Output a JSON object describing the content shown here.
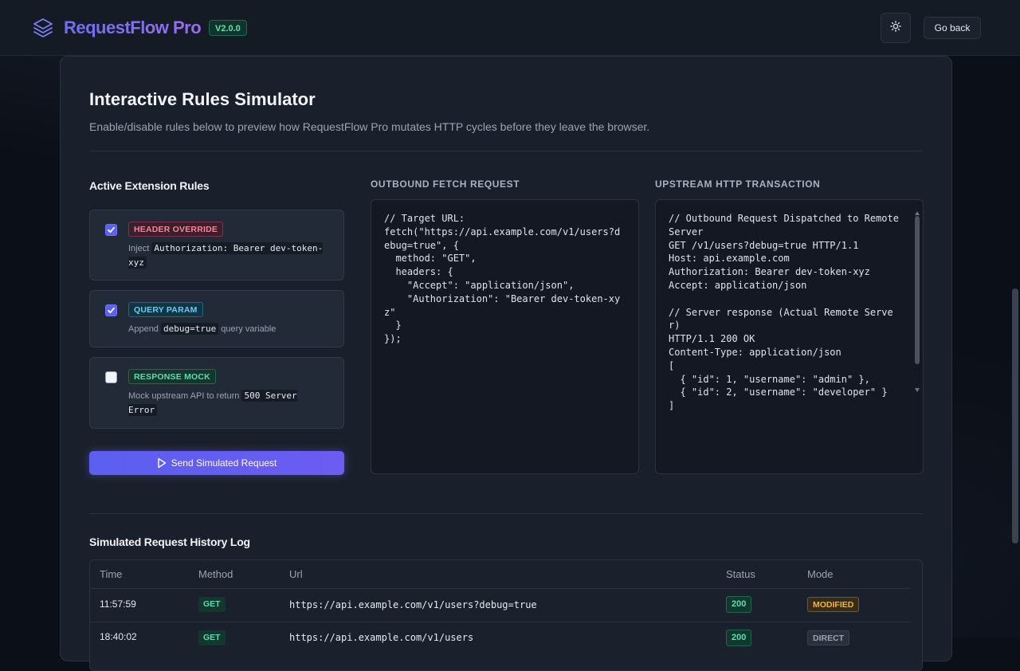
{
  "header": {
    "app_name": "RequestFlow Pro",
    "version": "V2.0.0",
    "go_back_label": "Go back"
  },
  "page": {
    "title": "Interactive Rules Simulator",
    "subtitle": "Enable/disable rules below to preview how RequestFlow Pro mutates HTTP cycles before they leave the browser."
  },
  "rules": {
    "title": "Active Extension Rules",
    "items": [
      {
        "tag": "HEADER OVERRIDE",
        "enabled": true,
        "desc_prefix": "Inject",
        "code": "Authorization: Bearer dev-token-xyz",
        "desc_suffix": ""
      },
      {
        "tag": "QUERY PARAM",
        "enabled": true,
        "desc_prefix": "Append",
        "code": "debug=true",
        "desc_suffix": "query variable"
      },
      {
        "tag": "RESPONSE MOCK",
        "enabled": false,
        "desc_prefix": "Mock upstream API to return",
        "code": "500 Server Error",
        "desc_suffix": ""
      }
    ],
    "send_label": "Send Simulated Request"
  },
  "outbound": {
    "label": "OUTBOUND FETCH REQUEST",
    "code": "// Target URL:\nfetch(\"https://api.example.com/v1/users?debug=true\", {\n  method: \"GET\",\n  headers: {\n    \"Accept\": \"application/json\",\n    \"Authorization\": \"Bearer dev-token-xyz\"\n  }\n});"
  },
  "upstream": {
    "label": "UPSTREAM HTTP TRANSACTION",
    "code": "// Outbound Request Dispatched to Remote Server\nGET /v1/users?debug=true HTTP/1.1\nHost: api.example.com\nAuthorization: Bearer dev-token-xyz\nAccept: application/json\n\n// Server response (Actual Remote Server)\nHTTP/1.1 200 OK\nContent-Type: application/json\n[\n  { \"id\": 1, \"username\": \"admin\" },\n  { \"id\": 2, \"username\": \"developer\" }\n]"
  },
  "history": {
    "title": "Simulated Request History Log",
    "columns": [
      "Time",
      "Method",
      "Url",
      "Status",
      "Mode"
    ],
    "rows": [
      {
        "time": "11:57:59",
        "method": "GET",
        "url": "https://api.example.com/v1/users?debug=true",
        "status": "200",
        "mode": "MODIFIED"
      },
      {
        "time": "18:40:02",
        "method": "GET",
        "url": "https://api.example.com/v1/users",
        "status": "200",
        "mode": "DIRECT"
      }
    ]
  }
}
